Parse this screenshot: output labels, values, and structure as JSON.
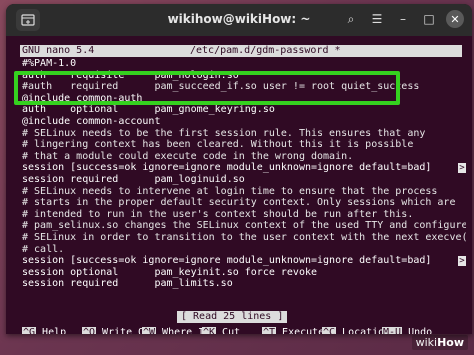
{
  "window": {
    "title": "wikihow@wikiHow: ~",
    "new_tab_icon": "terminal-plus-icon",
    "search_icon": "⌕",
    "menu_icon": "☰",
    "minimize_icon": "–",
    "maximize_icon": "□",
    "close_icon": "✕"
  },
  "nano": {
    "version": "GNU nano 5.4",
    "filename": "/etc/pam.d/gdm-password *",
    "status": "[ Read 25 lines ]"
  },
  "lines": [
    {
      "text": "#%PAM-1.0",
      "marker": ""
    },
    {
      "text": "auth    requisite     pam_nologin.so",
      "marker": ""
    },
    {
      "text": "#auth   required      pam_succeed_if.so user != root quiet_success",
      "marker": ""
    },
    {
      "text": "@include common-auth",
      "marker": ""
    },
    {
      "text": "auth    optional      pam_gnome_keyring.so",
      "marker": ""
    },
    {
      "text": "@include common-account",
      "marker": ""
    },
    {
      "text": "# SELinux needs to be the first session rule. This ensures that any",
      "marker": ""
    },
    {
      "text": "# lingering context has been cleared. Without this it is possible",
      "marker": ""
    },
    {
      "text": "# that a module could execute code in the wrong domain.",
      "marker": ""
    },
    {
      "text": "session [success=ok ignore=ignore module_unknown=ignore default=bad]        pam",
      "marker": ">"
    },
    {
      "text": "session required      pam_loginuid.so",
      "marker": ""
    },
    {
      "text": "# SELinux needs to intervene at login time to ensure that the process",
      "marker": ""
    },
    {
      "text": "# starts in the proper default security context. Only sessions which are",
      "marker": ""
    },
    {
      "text": "# intended to run in the user's context should be run after this.",
      "marker": ""
    },
    {
      "text": "# pam_selinux.so changes the SELinux context of the used TTY and configures",
      "marker": ""
    },
    {
      "text": "# SELinux in order to transition to the user context with the next execve()",
      "marker": ""
    },
    {
      "text": "# call.",
      "marker": ""
    },
    {
      "text": "session [success=ok ignore=ignore module_unknown=ignore default=bad]        pam",
      "marker": ">"
    },
    {
      "text": "session optional      pam_keyinit.so force revoke",
      "marker": ""
    },
    {
      "text": "session required      pam_limits.so",
      "marker": ""
    }
  ],
  "shortcuts": [
    [
      {
        "key": "^G",
        "label": "Help"
      },
      {
        "key": "^O",
        "label": "Write Out"
      },
      {
        "key": "^W",
        "label": "Where Is"
      },
      {
        "key": "^K",
        "label": "Cut"
      },
      {
        "key": "^T",
        "label": "Execute"
      },
      {
        "key": "^C",
        "label": "Location"
      },
      {
        "key": "M-U",
        "label": "Undo"
      }
    ],
    [
      {
        "key": "^X",
        "label": "Exit"
      },
      {
        "key": "^R",
        "label": "Read File"
      },
      {
        "key": "^\\",
        "label": "Replace"
      },
      {
        "key": "^U",
        "label": "Paste"
      },
      {
        "key": "^J",
        "label": "Justify"
      },
      {
        "key": "^_",
        "label": "Go To Line"
      },
      {
        "key": "M-E",
        "label": "Redo"
      }
    ]
  ],
  "watermark": {
    "prefix": "wiki",
    "suffix": "How"
  },
  "colors": {
    "terminal_bg": "#300a24",
    "highlight": "#35d11f",
    "bar_bg": "#dcdcdc"
  }
}
